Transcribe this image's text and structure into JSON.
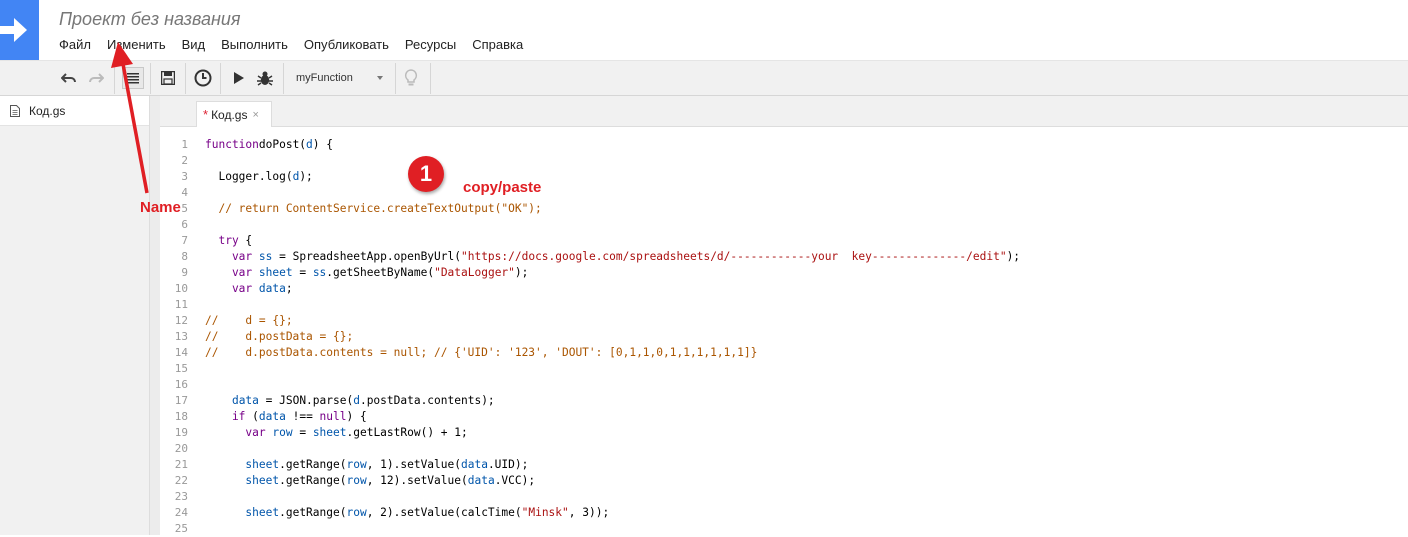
{
  "header": {
    "title": "Проект без названия",
    "menu": [
      "Файл",
      "Изменить",
      "Вид",
      "Выполнить",
      "Опубликовать",
      "Ресурсы",
      "Справка"
    ]
  },
  "toolbar": {
    "function_select": "myFunction"
  },
  "sidebar": {
    "files": [
      {
        "name": "Код.gs"
      }
    ]
  },
  "editor": {
    "tab": {
      "label": "Код.gs",
      "modified_mark": "*",
      "close": "×"
    },
    "lines": [
      {
        "n": "1",
        "segs": [
          [
            "kw",
            "function"
          ],
          [
            "",
            "doPost("
          ],
          [
            "var",
            "d"
          ],
          [
            "",
            ") {"
          ]
        ]
      },
      {
        "n": "2",
        "segs": []
      },
      {
        "n": "3",
        "segs": [
          [
            "",
            "  Logger.log("
          ],
          [
            "var",
            "d"
          ],
          [
            "",
            ");"
          ]
        ]
      },
      {
        "n": "4",
        "segs": []
      },
      {
        "n": "5",
        "segs": [
          [
            "cm",
            "  // return ContentService.createTextOutput(\"OK\");"
          ]
        ]
      },
      {
        "n": "6",
        "segs": []
      },
      {
        "n": "7",
        "segs": [
          [
            "kw",
            "  try"
          ],
          [
            "",
            " {"
          ]
        ]
      },
      {
        "n": "8",
        "segs": [
          [
            "kw",
            "    var"
          ],
          [
            "",
            " "
          ],
          [
            "var",
            "ss"
          ],
          [
            "",
            " = SpreadsheetApp.openByUrl("
          ],
          [
            "str",
            "\"https://docs.google.com/spreadsheets/d/------------your  key--------------/edit\""
          ],
          [
            "",
            ");"
          ]
        ]
      },
      {
        "n": "9",
        "segs": [
          [
            "kw",
            "    var"
          ],
          [
            "",
            " "
          ],
          [
            "var",
            "sheet"
          ],
          [
            "",
            " = "
          ],
          [
            "var",
            "ss"
          ],
          [
            "",
            ".getSheetByName("
          ],
          [
            "str",
            "\"DataLogger\""
          ],
          [
            "",
            ");"
          ]
        ]
      },
      {
        "n": "10",
        "segs": [
          [
            "kw",
            "    var"
          ],
          [
            "",
            " "
          ],
          [
            "var",
            "data"
          ],
          [
            "",
            ";"
          ]
        ]
      },
      {
        "n": "11",
        "segs": []
      },
      {
        "n": "12",
        "segs": [
          [
            "cm",
            "//    d = {};"
          ]
        ]
      },
      {
        "n": "13",
        "segs": [
          [
            "cm",
            "//    d.postData = {};"
          ]
        ]
      },
      {
        "n": "14",
        "segs": [
          [
            "cm",
            "//    d.postData.contents = null; // {'UID': '123', 'DOUT': [0,1,1,0,1,1,1,1,1,1]}"
          ]
        ]
      },
      {
        "n": "15",
        "segs": []
      },
      {
        "n": "16",
        "segs": []
      },
      {
        "n": "17",
        "segs": [
          [
            "",
            "    "
          ],
          [
            "var",
            "data"
          ],
          [
            "",
            " = JSON.parse("
          ],
          [
            "var",
            "d"
          ],
          [
            "",
            ".postData.contents);"
          ]
        ]
      },
      {
        "n": "18",
        "segs": [
          [
            "kw",
            "    if"
          ],
          [
            "",
            " ("
          ],
          [
            "var",
            "data"
          ],
          [
            "",
            " !== "
          ],
          [
            "kw",
            "null"
          ],
          [
            "",
            ") {"
          ]
        ]
      },
      {
        "n": "19",
        "segs": [
          [
            "kw",
            "      var"
          ],
          [
            "",
            " "
          ],
          [
            "var",
            "row"
          ],
          [
            "",
            " = "
          ],
          [
            "var",
            "sheet"
          ],
          [
            "",
            ".getLastRow() + 1;"
          ]
        ]
      },
      {
        "n": "20",
        "segs": []
      },
      {
        "n": "21",
        "segs": [
          [
            "",
            "      "
          ],
          [
            "var",
            "sheet"
          ],
          [
            "",
            ".getRange("
          ],
          [
            "var",
            "row"
          ],
          [
            "",
            ", 1).setValue("
          ],
          [
            "var",
            "data"
          ],
          [
            "",
            ".UID);"
          ]
        ]
      },
      {
        "n": "22",
        "segs": [
          [
            "",
            "      "
          ],
          [
            "var",
            "sheet"
          ],
          [
            "",
            ".getRange("
          ],
          [
            "var",
            "row"
          ],
          [
            "",
            ", 12).setValue("
          ],
          [
            "var",
            "data"
          ],
          [
            "",
            ".VCC);"
          ]
        ]
      },
      {
        "n": "23",
        "segs": []
      },
      {
        "n": "24",
        "segs": [
          [
            "",
            "      "
          ],
          [
            "var",
            "sheet"
          ],
          [
            "",
            ".getRange("
          ],
          [
            "var",
            "row"
          ],
          [
            "",
            ", 2).setValue(calcTime("
          ],
          [
            "str",
            "\"Minsk\""
          ],
          [
            "",
            ", 3));"
          ]
        ]
      },
      {
        "n": "25",
        "segs": []
      }
    ]
  },
  "annotations": {
    "badge_number": "1",
    "copy_paste": "copy/paste",
    "name": "Name",
    "color": "#e01f24"
  }
}
